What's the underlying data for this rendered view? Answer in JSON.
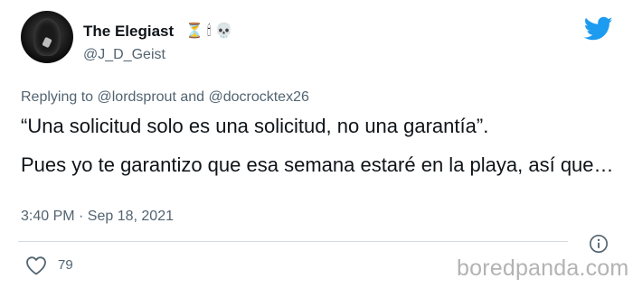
{
  "author": {
    "display_name": "The Elegiast",
    "emojis": "⏳🕯💀",
    "handle": "@J_D_Geist"
  },
  "tweet": {
    "replying_to": "Replying to @lordsprout and @docrocktex26",
    "text_line1": "“Una solicitud solo es una solicitud, no una garantía”.",
    "text_line2": "Pues yo te garantizo que esa semana estaré en la playa, así que…",
    "timestamp": "3:40 PM · Sep 18, 2021"
  },
  "engagement": {
    "likes": "79"
  },
  "watermark": "boredpanda.com",
  "colors": {
    "twitter_blue": "#1d9bf0",
    "secondary_text": "#536471",
    "primary_text": "#0f1419"
  },
  "icons": [
    "twitter-bird-icon",
    "info-icon",
    "heart-icon"
  ]
}
